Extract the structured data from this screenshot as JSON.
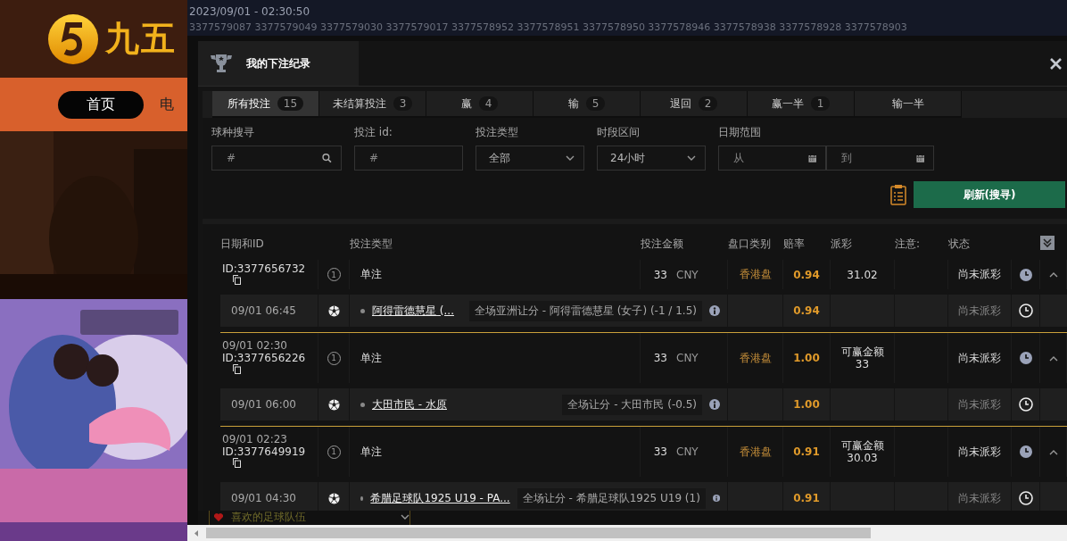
{
  "site": {
    "logo_text": "九五",
    "nav": [
      {
        "label": "首页",
        "selected": true
      },
      {
        "label": "电",
        "selected": false
      }
    ]
  },
  "topbar": {
    "datetime": "2023/09/01 - 02:30:50",
    "ticker": "3377579087 3377579049 3377579030 3377579017 3377578952 3377578951 3377578950 3377578946 3377578938 3377578928 3377578903"
  },
  "modal": {
    "title": "我的下注纪录",
    "tabs": [
      {
        "label": "所有投注",
        "count": "15",
        "selected": true
      },
      {
        "label": "未结算投注",
        "count": "3",
        "selected": false
      },
      {
        "label": "赢",
        "count": "4",
        "selected": false
      },
      {
        "label": "输",
        "count": "5",
        "selected": false
      },
      {
        "label": "退回",
        "count": "2",
        "selected": false
      },
      {
        "label": "赢一半",
        "count": "1",
        "selected": false
      },
      {
        "label": "输一半",
        "selected": false
      }
    ],
    "filters": [
      {
        "label": "球种搜寻",
        "kind": "search",
        "placeholder": "#"
      },
      {
        "label": "投注 id:",
        "kind": "text",
        "placeholder": "#"
      },
      {
        "label": "投注类型",
        "kind": "select",
        "value": "全部"
      },
      {
        "label": "时段区间",
        "kind": "select",
        "value": "24小时"
      },
      {
        "label": "日期范围",
        "kind": "daterange",
        "from_placeholder": "从",
        "to_placeholder": "到"
      }
    ],
    "refresh_button": "刷新(搜寻)",
    "columns": [
      "日期和ID",
      "投注类型",
      "投注金额",
      "盘口类别",
      "赔率",
      "派彩",
      "注意:",
      "状态"
    ],
    "bets": [
      {
        "id": "ID:3377656732",
        "leg_count": "1",
        "type": "单注",
        "amount": "33",
        "currency": "CNY",
        "market": "香港盘",
        "odds": "0.94",
        "payout": "31.02",
        "status": "尚未派彩",
        "expanded": true,
        "legs": [
          {
            "time": "09/01 06:45",
            "match": "阿得雷德慧星 (...",
            "bet": "全场亚洲让分 - 阿得雷德慧星 (女子) (-1 / 1.5)",
            "odds": "0.94",
            "status": "尚未派彩"
          }
        ]
      },
      {
        "date": "09/01 02:30",
        "id": "ID:3377656226",
        "leg_count": "1",
        "type": "单注",
        "amount": "33",
        "currency": "CNY",
        "market": "香港盘",
        "odds": "1.00",
        "payout_label": "可赢金额",
        "payout": "33",
        "status": "尚未派彩",
        "expanded": true,
        "legs": [
          {
            "time": "09/01 06:00",
            "match": "大田市民 - 水原",
            "bet": "全场让分 - 大田市民 (-0.5)",
            "odds": "1.00",
            "status": "尚未派彩"
          }
        ]
      },
      {
        "date": "09/01 02:23",
        "id": "ID:3377649919",
        "leg_count": "1",
        "type": "单注",
        "amount": "33",
        "currency": "CNY",
        "market": "香港盘",
        "odds": "0.91",
        "payout_label": "可赢金额",
        "payout": "30.03",
        "status": "尚未派彩",
        "expanded": true,
        "legs": [
          {
            "time": "09/01 04:30",
            "match": "希腊足球队1925 U19 - PA...",
            "bet": "全场让分 - 希腊足球队1925 U19 (1)",
            "odds": "0.91",
            "status": "尚未派彩"
          }
        ]
      }
    ]
  },
  "bottom": {
    "favorite_label": "喜欢的足球队伍"
  }
}
